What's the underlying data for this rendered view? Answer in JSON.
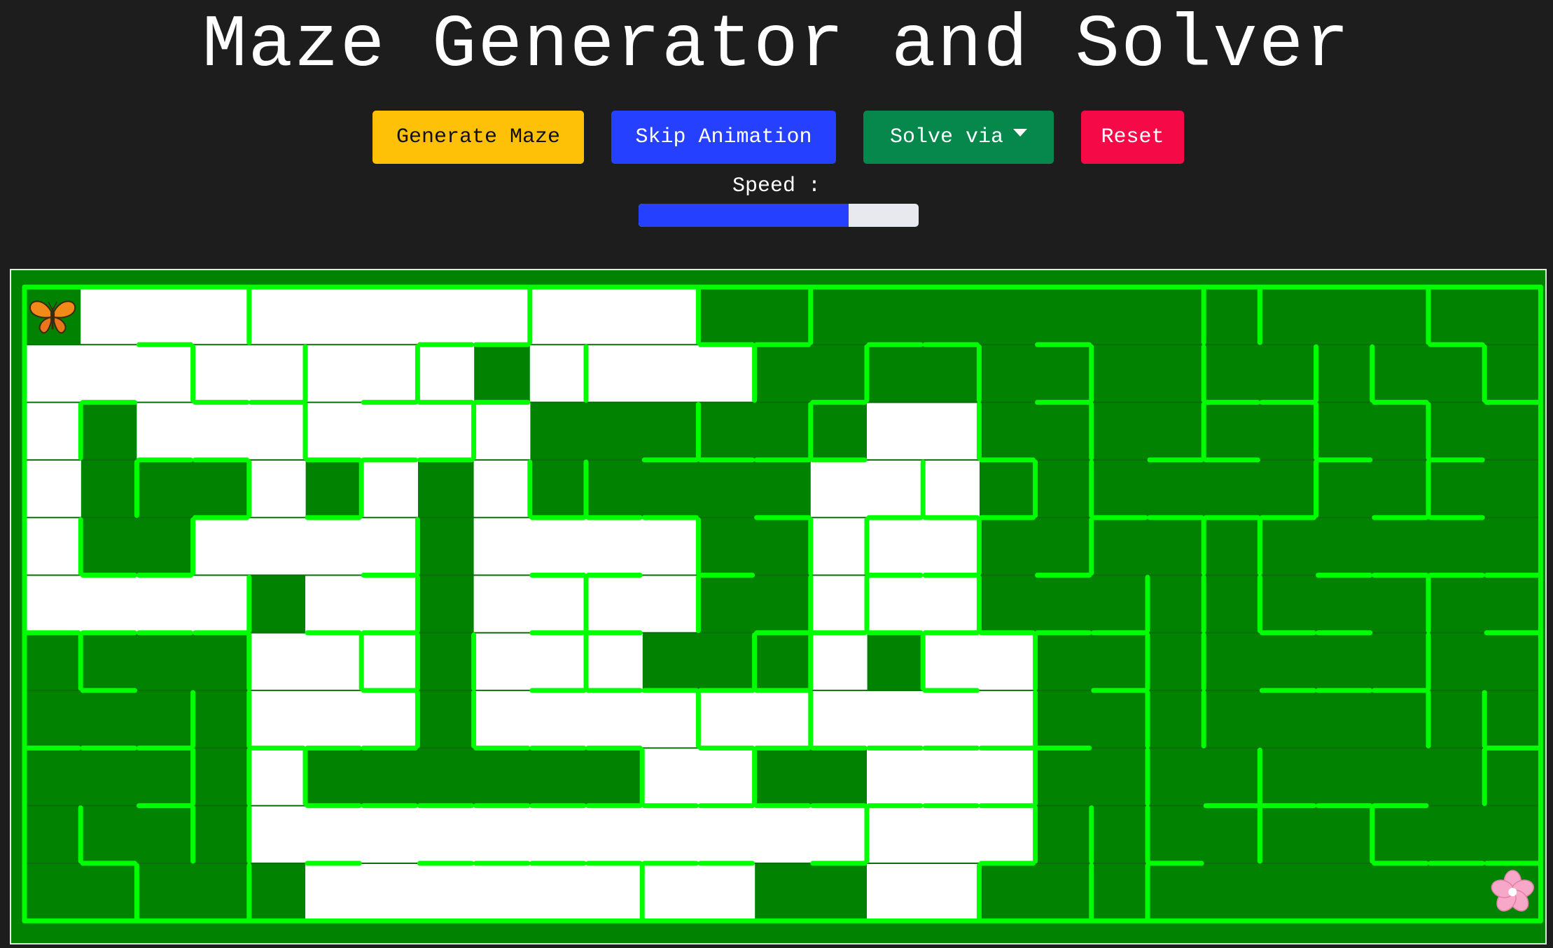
{
  "header": {
    "title": "Maze Generator and Solver"
  },
  "toolbar": {
    "generate_label": "Generate Maze",
    "skip_label": "Skip Animation",
    "solve_label": "Solve via",
    "reset_label": "Reset"
  },
  "speed": {
    "label": "Speed :",
    "value_fraction": 0.75
  },
  "maze": {
    "cols": 27,
    "rows": 11,
    "colors": {
      "background": "#018201",
      "wall": "#00ff00",
      "visited": "#ffffff",
      "frame": "#e8e8e8"
    },
    "start_icon": "butterfly-icon",
    "end_icon": "cherry-blossom-icon",
    "visited_rows": [
      [
        0,
        1,
        1,
        1,
        1,
        1,
        1,
        1,
        1,
        1,
        1,
        1,
        0,
        0,
        0,
        0,
        0,
        0,
        0,
        0,
        0,
        0,
        0,
        0,
        0,
        0,
        0
      ],
      [
        1,
        1,
        1,
        1,
        1,
        1,
        1,
        1,
        0,
        1,
        1,
        1,
        1,
        0,
        0,
        0,
        0,
        0,
        0,
        0,
        0,
        0,
        0,
        0,
        0,
        0,
        0
      ],
      [
        1,
        0,
        1,
        1,
        1,
        1,
        1,
        1,
        1,
        0,
        0,
        0,
        0,
        0,
        0,
        1,
        1,
        0,
        0,
        0,
        0,
        0,
        0,
        0,
        0,
        0,
        0
      ],
      [
        1,
        0,
        0,
        0,
        1,
        0,
        1,
        0,
        1,
        0,
        0,
        0,
        0,
        0,
        1,
        1,
        1,
        0,
        0,
        0,
        0,
        0,
        0,
        0,
        0,
        0,
        0
      ],
      [
        1,
        0,
        0,
        1,
        1,
        1,
        1,
        0,
        1,
        1,
        1,
        1,
        0,
        0,
        1,
        1,
        1,
        0,
        0,
        0,
        0,
        0,
        0,
        0,
        0,
        0,
        0
      ],
      [
        1,
        1,
        1,
        1,
        0,
        1,
        1,
        0,
        1,
        1,
        1,
        1,
        0,
        0,
        1,
        1,
        1,
        0,
        0,
        0,
        0,
        0,
        0,
        0,
        0,
        0,
        0
      ],
      [
        0,
        0,
        0,
        0,
        1,
        1,
        1,
        0,
        1,
        1,
        1,
        0,
        0,
        0,
        1,
        0,
        1,
        1,
        0,
        0,
        0,
        0,
        0,
        0,
        0,
        0,
        0
      ],
      [
        0,
        0,
        0,
        0,
        1,
        1,
        1,
        0,
        1,
        1,
        1,
        1,
        1,
        1,
        1,
        1,
        1,
        1,
        0,
        0,
        0,
        0,
        0,
        0,
        0,
        0,
        0
      ],
      [
        0,
        0,
        0,
        0,
        1,
        0,
        0,
        0,
        0,
        0,
        0,
        1,
        1,
        0,
        0,
        1,
        1,
        1,
        0,
        0,
        0,
        0,
        0,
        0,
        0,
        0,
        0
      ],
      [
        0,
        0,
        0,
        0,
        1,
        1,
        1,
        1,
        1,
        1,
        1,
        1,
        1,
        1,
        1,
        1,
        1,
        1,
        0,
        0,
        0,
        0,
        0,
        0,
        0,
        0,
        0
      ],
      [
        0,
        0,
        0,
        0,
        0,
        1,
        1,
        1,
        1,
        1,
        1,
        1,
        1,
        0,
        0,
        1,
        1,
        0,
        0,
        0,
        0,
        0,
        0,
        0,
        0,
        0,
        0
      ]
    ],
    "horizontal_walls_below": [
      [
        0,
        0,
        1,
        0,
        0,
        0,
        0,
        1,
        1,
        0,
        0,
        0,
        1,
        1,
        0,
        1,
        1,
        0,
        1,
        0,
        0,
        0,
        0,
        0,
        0,
        1,
        0
      ],
      [
        0,
        1,
        0,
        1,
        1,
        0,
        1,
        1,
        1,
        0,
        0,
        0,
        0,
        0,
        1,
        0,
        0,
        0,
        1,
        0,
        0,
        1,
        1,
        0,
        1,
        0,
        1
      ],
      [
        0,
        0,
        1,
        1,
        0,
        1,
        1,
        1,
        0,
        0,
        0,
        1,
        1,
        1,
        1,
        0,
        0,
        1,
        0,
        0,
        1,
        1,
        0,
        1,
        0,
        1,
        0
      ],
      [
        0,
        0,
        0,
        1,
        0,
        1,
        0,
        0,
        0,
        1,
        1,
        1,
        0,
        1,
        0,
        1,
        1,
        1,
        0,
        1,
        1,
        1,
        1,
        0,
        1,
        1,
        0
      ],
      [
        0,
        1,
        1,
        0,
        0,
        0,
        1,
        0,
        0,
        1,
        1,
        0,
        1,
        0,
        0,
        1,
        1,
        0,
        1,
        0,
        0,
        0,
        0,
        1,
        1,
        1,
        1
      ],
      [
        1,
        1,
        1,
        1,
        0,
        1,
        1,
        0,
        0,
        1,
        1,
        0,
        0,
        1,
        1,
        1,
        1,
        1,
        1,
        1,
        0,
        0,
        1,
        1,
        0,
        0,
        1
      ],
      [
        0,
        1,
        0,
        0,
        0,
        0,
        1,
        0,
        0,
        1,
        1,
        1,
        1,
        1,
        0,
        0,
        1,
        0,
        0,
        1,
        0,
        0,
        1,
        1,
        1,
        0,
        0
      ],
      [
        1,
        1,
        1,
        0,
        1,
        1,
        1,
        0,
        1,
        1,
        1,
        0,
        1,
        1,
        1,
        1,
        1,
        1,
        1,
        0,
        0,
        0,
        0,
        0,
        0,
        0,
        1
      ],
      [
        0,
        0,
        1,
        0,
        0,
        1,
        1,
        1,
        1,
        1,
        1,
        1,
        1,
        1,
        1,
        1,
        1,
        1,
        0,
        0,
        0,
        1,
        1,
        1,
        1,
        0,
        0
      ],
      [
        0,
        1,
        0,
        0,
        0,
        1,
        0,
        1,
        1,
        1,
        1,
        1,
        1,
        0,
        1,
        0,
        0,
        1,
        0,
        0,
        1,
        0,
        0,
        0,
        1,
        1,
        1
      ]
    ],
    "vertical_walls_right": [
      [
        0,
        0,
        0,
        1,
        0,
        0,
        0,
        0,
        1,
        0,
        0,
        1,
        0,
        1,
        0,
        0,
        0,
        0,
        0,
        0,
        1,
        1,
        0,
        0,
        1,
        0
      ],
      [
        0,
        0,
        1,
        0,
        1,
        0,
        1,
        0,
        0,
        1,
        0,
        0,
        1,
        0,
        1,
        0,
        1,
        0,
        1,
        0,
        1,
        0,
        1,
        1,
        0,
        1
      ],
      [
        1,
        0,
        0,
        0,
        1,
        0,
        0,
        1,
        0,
        0,
        0,
        1,
        0,
        1,
        0,
        0,
        1,
        0,
        1,
        0,
        1,
        0,
        1,
        0,
        1,
        0
      ],
      [
        0,
        1,
        0,
        1,
        0,
        1,
        0,
        0,
        1,
        1,
        0,
        0,
        0,
        0,
        0,
        1,
        0,
        1,
        1,
        0,
        0,
        0,
        1,
        0,
        1,
        0
      ],
      [
        1,
        0,
        1,
        0,
        0,
        0,
        1,
        0,
        0,
        0,
        0,
        1,
        0,
        1,
        1,
        0,
        1,
        0,
        1,
        0,
        1,
        1,
        0,
        0,
        0,
        0
      ],
      [
        0,
        0,
        0,
        1,
        0,
        0,
        1,
        0,
        0,
        1,
        0,
        1,
        0,
        1,
        1,
        0,
        1,
        0,
        0,
        1,
        1,
        1,
        0,
        0,
        1,
        0
      ],
      [
        1,
        0,
        0,
        1,
        0,
        1,
        1,
        1,
        0,
        1,
        0,
        0,
        1,
        1,
        0,
        1,
        0,
        1,
        0,
        1,
        1,
        0,
        0,
        0,
        1,
        0
      ],
      [
        0,
        0,
        1,
        1,
        0,
        0,
        1,
        1,
        0,
        0,
        0,
        1,
        0,
        1,
        0,
        0,
        0,
        1,
        0,
        1,
        1,
        0,
        0,
        0,
        1,
        1
      ],
      [
        0,
        0,
        1,
        1,
        1,
        0,
        0,
        0,
        0,
        0,
        1,
        0,
        1,
        0,
        0,
        0,
        0,
        1,
        0,
        1,
        0,
        1,
        0,
        0,
        0,
        1
      ],
      [
        1,
        0,
        1,
        1,
        0,
        0,
        0,
        0,
        0,
        0,
        0,
        0,
        0,
        0,
        1,
        0,
        0,
        1,
        1,
        1,
        0,
        1,
        0,
        1,
        0,
        0
      ],
      [
        0,
        1,
        0,
        1,
        0,
        0,
        0,
        0,
        0,
        0,
        1,
        0,
        0,
        0,
        0,
        0,
        1,
        0,
        1,
        1,
        0,
        0,
        0,
        0,
        0,
        0
      ]
    ]
  }
}
